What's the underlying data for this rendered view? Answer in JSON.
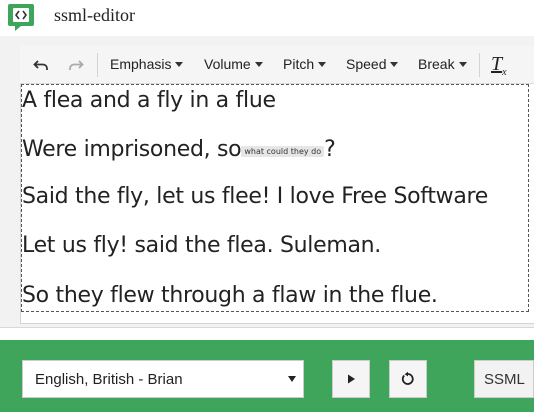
{
  "app": {
    "title": "ssml-editor",
    "logo_icon": "code-brackets-icon"
  },
  "toolbar": {
    "undo_icon": "undo-icon",
    "redo_icon": "redo-icon",
    "menus": [
      "Emphasis",
      "Volume",
      "Pitch",
      "Speed",
      "Break"
    ],
    "clear_format_label": "T",
    "clear_format_sub": "x"
  },
  "editor": {
    "lines": [
      "A flea and a fly in a flue",
      "Were imprisoned, so",
      "Said the fly, let us flee! I love Free Software",
      "Let us fly! said the flea. Suleman.",
      "So they flew through a flaw in the flue."
    ],
    "line2_tag": "what could they do",
    "line2_end": "?"
  },
  "bottom": {
    "voice_selected": "English, British - Brian",
    "play_icon": "play-icon",
    "reset_icon": "refresh-icon",
    "ssml_label": "SSML"
  },
  "colors": {
    "accent_green": "#3fa55b",
    "logo_green": "#3fa55b"
  }
}
